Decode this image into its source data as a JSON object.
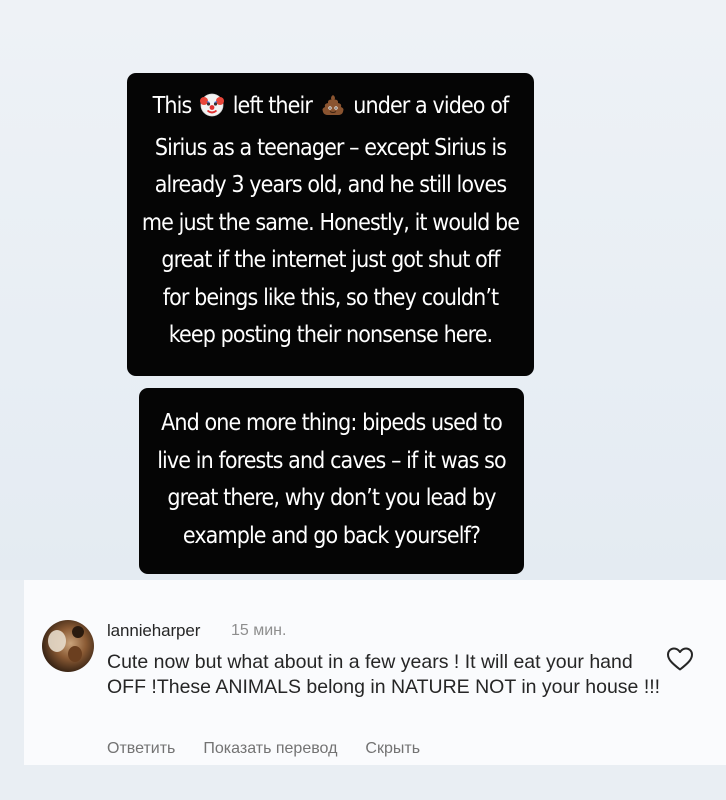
{
  "story": {
    "bubble1": {
      "line1_before": "This",
      "line1_middle": "left their",
      "line1_after": "under a video of",
      "icon1": "clown-face-emoji",
      "icon2": "pile-of-poo-emoji",
      "lines": [
        "Sirius as a teenager – except Sirius is",
        "already 3 years old, and he still loves",
        "me just the same. Honestly, it would be",
        "great if the internet just got shut off",
        "for beings like this, so they couldn’t",
        "keep posting their nonsense here."
      ]
    },
    "bubble2": {
      "lines": [
        "And one more thing: bipeds used to",
        "live in forests and caves – if it was so",
        "great there, why don’t you lead by",
        "example and go back yourself?"
      ]
    }
  },
  "comment": {
    "username": "lannieharper",
    "timestamp": "15 мин.",
    "text": "Cute now but what about in a few years ! It will eat your hand OFF !These ANIMALS belong in NATURE NOT in your house !!!",
    "like_icon": "heart-outline-icon",
    "actions": {
      "reply": "Ответить",
      "translate": "Показать перевод",
      "hide": "Скрыть"
    }
  },
  "colors": {
    "bubble_bg": "#050505",
    "bubble_text": "#ffffff",
    "panel_bg": "#fafbfd",
    "muted_text": "#8e8e8e"
  }
}
